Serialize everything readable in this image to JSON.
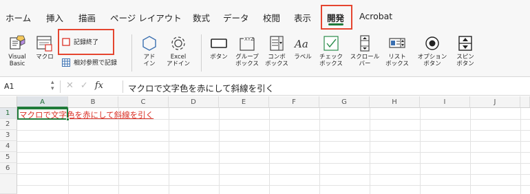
{
  "tabs": [
    {
      "label": "ホーム"
    },
    {
      "label": "挿入"
    },
    {
      "label": "描画"
    },
    {
      "label": "ページ レイアウト"
    },
    {
      "label": "数式"
    },
    {
      "label": "データ"
    },
    {
      "label": "校閲"
    },
    {
      "label": "表示"
    },
    {
      "label": "開発"
    },
    {
      "label": "Acrobat"
    }
  ],
  "active_tab": "開発",
  "ribbon": {
    "visual_basic": "Visual\nBasic",
    "macro": "マクロ",
    "stop_recording": "記録終了",
    "relative_reference": "相対参照で記録",
    "add_ins": "アド\nイン",
    "excel_add_ins": "Excel\nアドイン",
    "button": "ボタン",
    "group_box": "グループ\nボックス",
    "combo_box": "コンボ\nボックス",
    "label": "ラベル",
    "check_box": "チェック\nボックス",
    "scroll_bar": "スクロール\nバー",
    "list_box": "リスト\nボックス",
    "option_button": "オプション\nボタン",
    "spin_button": "スピン\nボタン"
  },
  "formula_bar": {
    "name_box": "A1",
    "fx": "fx",
    "content": "マクロで文字色を赤にして斜線を引く"
  },
  "columns": [
    "A",
    "B",
    "C",
    "D",
    "E",
    "F",
    "G",
    "H",
    "I",
    "J"
  ],
  "rows": [
    "1",
    "2",
    "3",
    "4",
    "5",
    "6"
  ],
  "cells": {
    "A1": "マクロで文字色を赤にして斜線を引く"
  },
  "colors": {
    "accent_green": "#1f7a3a",
    "highlight_red": "#e5452f",
    "cell_text_red": "#d93025"
  }
}
